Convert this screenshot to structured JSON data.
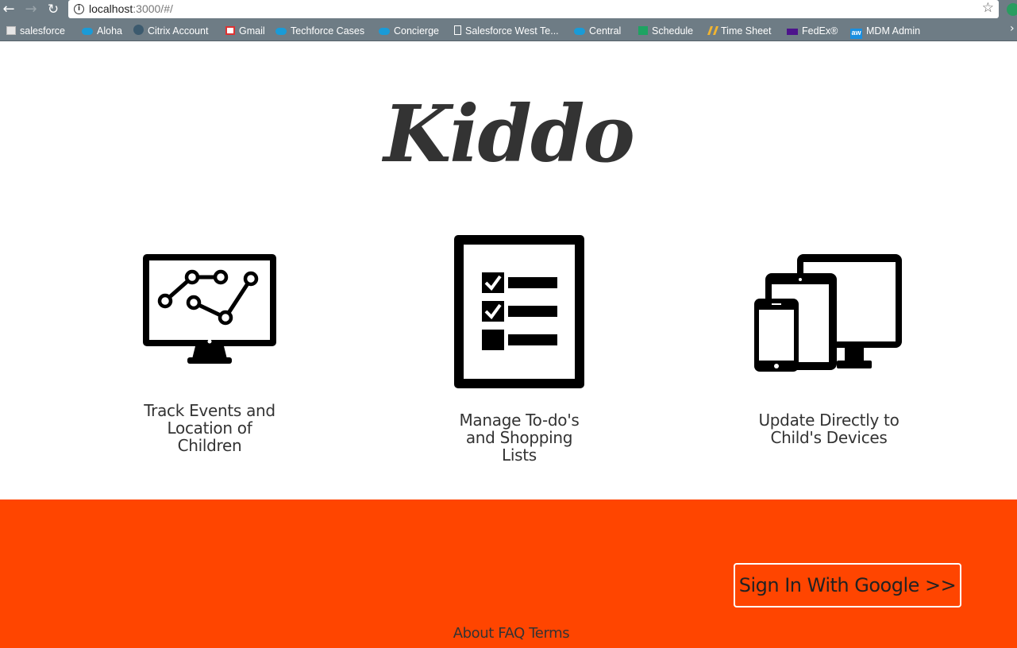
{
  "browser": {
    "url_host": "localhost",
    "url_rest": ":3000/#/",
    "back_icon": "←",
    "forward_icon": "→",
    "reload_icon": "↻",
    "info_icon": "i",
    "star_icon": "☆",
    "more_icon": "›"
  },
  "bookmarks": [
    {
      "label": "salesforce",
      "icon": "folder-icon"
    },
    {
      "label": "Aloha",
      "icon": "cloud-icon"
    },
    {
      "label": "Citrix Account",
      "icon": "citrix-icon"
    },
    {
      "label": "Gmail",
      "icon": "gmail-icon"
    },
    {
      "label": "Techforce Cases",
      "icon": "cloud-icon"
    },
    {
      "label": "Concierge",
      "icon": "cloud-icon"
    },
    {
      "label": "Salesforce West Te...",
      "icon": "document-icon"
    },
    {
      "label": "Central",
      "icon": "cloud-icon"
    },
    {
      "label": "Schedule",
      "icon": "sheets-icon"
    },
    {
      "label": "Time Sheet",
      "icon": "timesheet-icon"
    },
    {
      "label": "FedEx®",
      "icon": "fedex-icon"
    },
    {
      "label": "MDM Admin",
      "icon": "aw-icon",
      "icon_text": "aw"
    }
  ],
  "page": {
    "logo": "Kiddo",
    "features": [
      {
        "caption_lines": [
          "Track Events and",
          "Location of",
          "Children"
        ],
        "icon": "monitor-chart-icon"
      },
      {
        "caption_lines": [
          "Manage To-do's",
          "and Shopping",
          "Lists"
        ],
        "icon": "checklist-icon"
      },
      {
        "caption_lines": [
          "Update Directly to",
          "Child's Devices"
        ],
        "icon": "devices-icon"
      }
    ],
    "signin_label": "Sign In With Google >>",
    "footer_links": [
      "About",
      "FAQ",
      "Terms"
    ]
  },
  "colors": {
    "accent": "#ff4500",
    "text": "#333333",
    "chrome": "#6e7c85"
  }
}
